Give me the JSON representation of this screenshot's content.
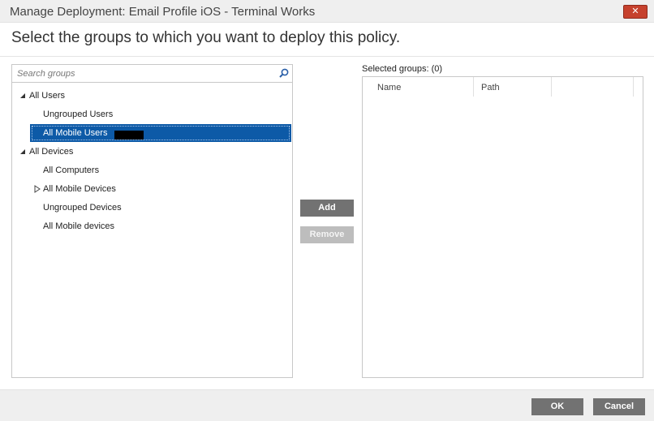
{
  "window": {
    "title": "Manage Deployment: Email Profile iOS - Terminal Works",
    "close_icon": "close-icon",
    "close_color": "#c6412d"
  },
  "heading": "Select the groups to which you want to deploy this policy.",
  "search": {
    "placeholder": "Search groups",
    "value": "",
    "icon": "search-icon"
  },
  "tree": {
    "items": [
      {
        "label": "All Users",
        "expander": "expanded"
      },
      {
        "label": "Ungrouped Users",
        "expander": "none"
      },
      {
        "label": "All Mobile Users",
        "expander": "none",
        "selected": true
      },
      {
        "label": "All Devices",
        "expander": "expanded"
      },
      {
        "label": "All Computers",
        "expander": "none"
      },
      {
        "label": "All Mobile Devices",
        "expander": "collapsed"
      },
      {
        "label": "Ungrouped Devices",
        "expander": "none"
      },
      {
        "label": "All Mobile devices",
        "expander": "none"
      }
    ]
  },
  "actions": {
    "add_label": "Add",
    "remove_label": "Remove"
  },
  "selected": {
    "label": "Selected groups: (0)",
    "columns": [
      "Name",
      "Path"
    ]
  },
  "footer": {
    "ok_label": "OK",
    "cancel_label": "Cancel"
  },
  "colors": {
    "selection": "#0d5aa7",
    "button": "#727272",
    "button_disabled": "#bdbdbd"
  }
}
